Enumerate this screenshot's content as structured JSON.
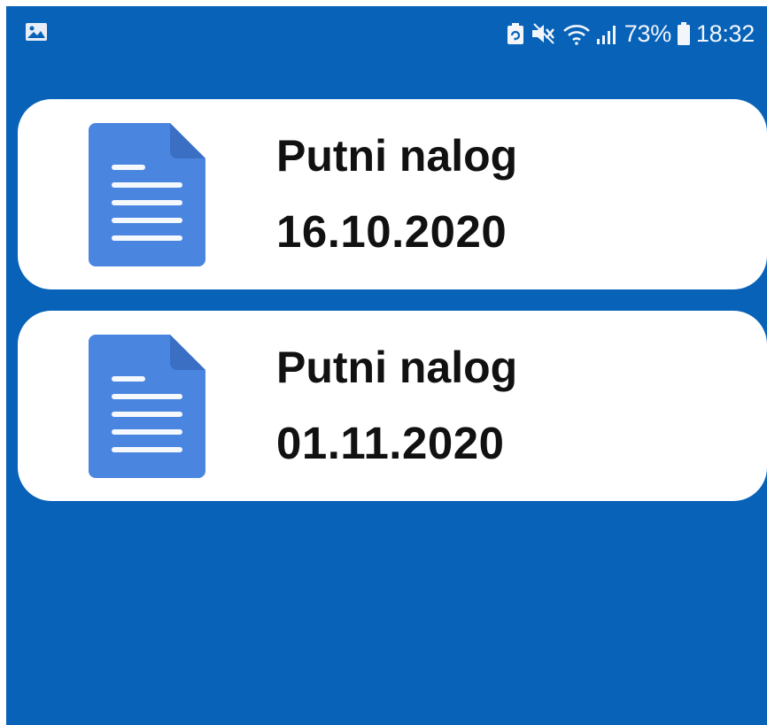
{
  "status_bar": {
    "icons": [
      "gallery-icon",
      "battery-saver-icon",
      "mute-icon",
      "wifi-icon",
      "signal-icon",
      "battery-icon"
    ],
    "battery_percent": "73%",
    "time": "18:32"
  },
  "colors": {
    "background": "#0762b8",
    "card": "#ffffff",
    "doc_icon": "#4a86e0",
    "doc_icon_fold": "#3a6fc4"
  },
  "documents": [
    {
      "title": "Putni nalog",
      "date": "16.10.2020",
      "icon": "document-icon"
    },
    {
      "title": "Putni nalog",
      "date": "01.11.2020",
      "icon": "document-icon"
    }
  ]
}
